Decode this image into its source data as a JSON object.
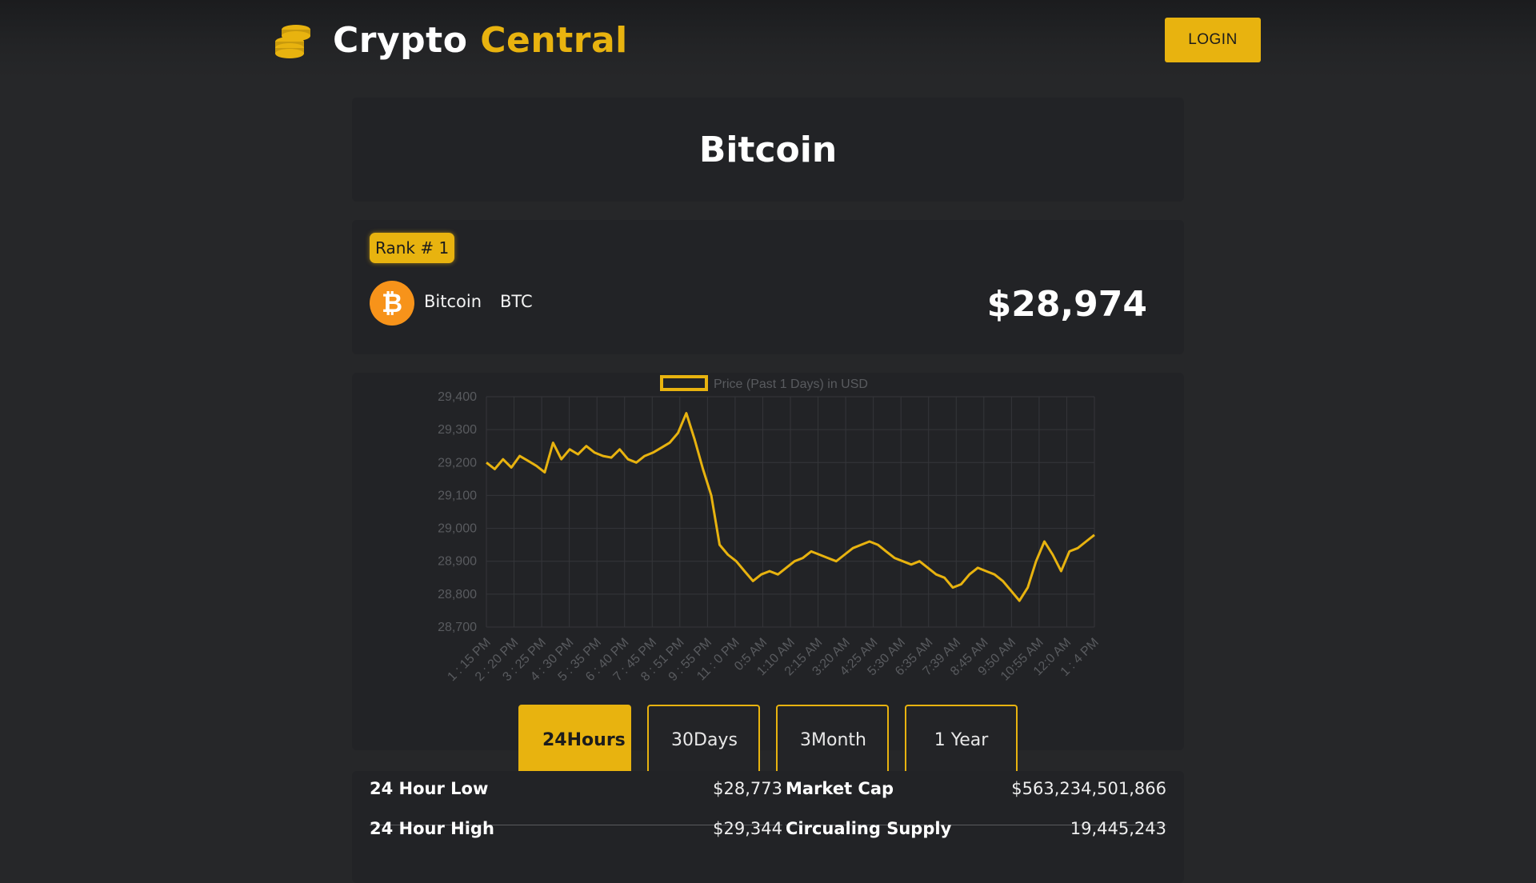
{
  "header": {
    "brand_first": "Crypto",
    "brand_second": "Central",
    "login_label": "LOGIN",
    "logo_icon": "coin-stack-icon"
  },
  "page": {
    "title": "Bitcoin"
  },
  "coin": {
    "rank_label": "Rank # 1",
    "name": "Bitcoin",
    "symbol": "BTC",
    "price": "$28,974",
    "logo_icon": "bitcoin-icon"
  },
  "chart_data": {
    "type": "line",
    "legend": "Price (Past 1 Days) in USD",
    "color": "#e8b30f",
    "ylim": [
      28700,
      29400
    ],
    "y_ticks": [
      "29,400",
      "29,300",
      "29,200",
      "29,100",
      "29,000",
      "28,900",
      "28,800",
      "28,700"
    ],
    "y_tick_values": [
      29400,
      29300,
      29200,
      29100,
      29000,
      28900,
      28800,
      28700
    ],
    "x_ticks": [
      "1 : 15 PM",
      "2 : 20 PM",
      "3 : 25 PM",
      "4 : 30 PM",
      "5 : 35 PM",
      "6 : 40 PM",
      "7 : 45 PM",
      "8 : 51 PM",
      "9 : 55 PM",
      "11 : 0 PM",
      "0:5 AM",
      "1:10 AM",
      "2:15 AM",
      "3:20 AM",
      "4:25 AM",
      "5:30 AM",
      "6:35 AM",
      "7:39 AM",
      "8:45 AM",
      "9:50 AM",
      "10:55 AM",
      "12:0 AM",
      "1 : 4 PM"
    ],
    "grid": true,
    "series": [
      {
        "values": [
          29200,
          29180,
          29210,
          29185,
          29220,
          29205,
          29190,
          29170,
          29260,
          29210,
          29240,
          29225,
          29250,
          29230,
          29220,
          29215,
          29240,
          29210,
          29200,
          29220,
          29230,
          29245,
          29260,
          29290,
          29350,
          29270,
          29180,
          29100,
          28950,
          28920,
          28900,
          28870,
          28840,
          28860,
          28870,
          28860,
          28880,
          28900,
          28910,
          28930,
          28920,
          28910,
          28900,
          28920,
          28940,
          28950,
          28960,
          28950,
          28930,
          28910,
          28900,
          28890,
          28900,
          28880,
          28860,
          28850,
          28820,
          28830,
          28860,
          28880,
          28870,
          28860,
          28840,
          28810,
          28780,
          28820,
          28900,
          28960,
          28920,
          28870,
          28930,
          28940,
          28960,
          28980
        ]
      }
    ]
  },
  "ranges": [
    {
      "line1": "24",
      "line2": "Hours",
      "active": true
    },
    {
      "line1": "30",
      "line2": "Days",
      "active": false
    },
    {
      "line1": "3",
      "line2": "Month",
      "active": false
    },
    {
      "line1": "1 Year",
      "line2": "",
      "active": false
    }
  ],
  "stats": {
    "low_label": "24 Hour Low",
    "low_value": "$28,773",
    "high_label": "24 Hour High",
    "high_value": "$29,344",
    "cap_label": "Market Cap",
    "cap_value": "$563,234,501,866",
    "supply_label": "Circualing Supply",
    "supply_value": "19,445,243"
  }
}
